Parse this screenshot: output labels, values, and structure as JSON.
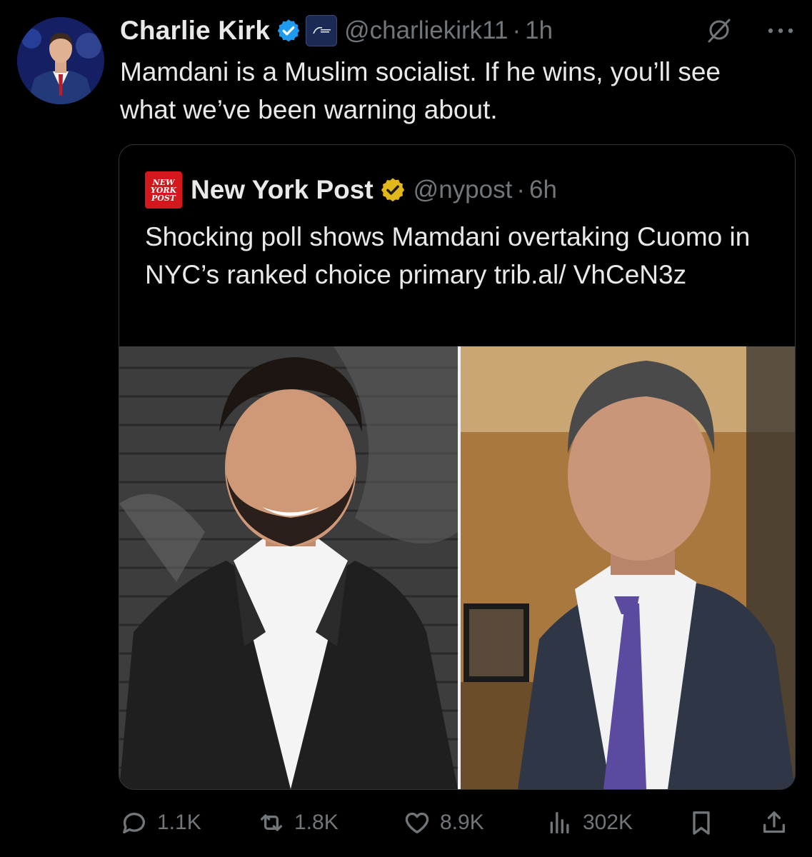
{
  "author": {
    "name": "Charlie Kirk",
    "handle": "@charliekirk11",
    "separator": "·",
    "time": "1h",
    "text": "Mamdani is a Muslim socialist. If he wins, you’ll see what we’ve been warning about."
  },
  "quote": {
    "logo_lines": [
      "NEW",
      "YORK",
      "POST"
    ],
    "name": "New York Post",
    "handle": "@nypost",
    "separator": "·",
    "time": "6h",
    "text": "Shocking poll shows Mamdani overtaking Cuomo in NYC’s ranked choice primary trib.al/ VhCeN3z"
  },
  "actions": {
    "replies": "1.1K",
    "reposts": "1.8K",
    "likes": "8.9K",
    "views": "302K"
  },
  "colors": {
    "background": "#000000",
    "text": "#e7e9ea",
    "muted": "#71767b",
    "verified_blue": "#1d9bf0",
    "verified_gold": "#e2b719",
    "nypost_red": "#d3171d",
    "border": "#333639"
  },
  "icons": [
    "verified-badge-icon",
    "affiliate-badge-icon",
    "grok-icon",
    "more-icon",
    "reply-icon",
    "repost-icon",
    "like-icon",
    "views-icon",
    "bookmark-icon",
    "share-icon"
  ]
}
